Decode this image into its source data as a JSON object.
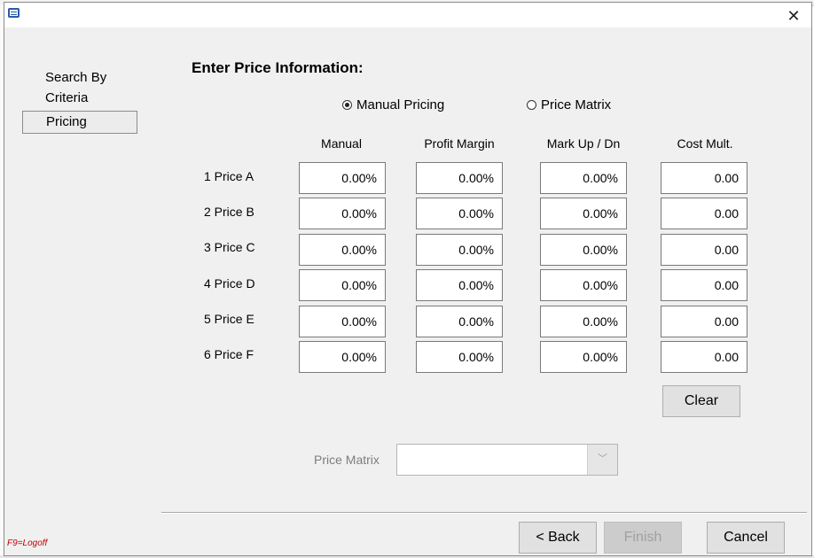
{
  "window": {
    "close_glyph": "✕"
  },
  "nav": {
    "items": [
      {
        "label_line1": "Search By",
        "label_line2": "Criteria"
      },
      {
        "label": "Pricing"
      }
    ]
  },
  "form": {
    "heading": "Enter Price Information:",
    "radios": [
      {
        "label": "Manual Pricing",
        "selected": true
      },
      {
        "label": "Price Matrix",
        "selected": false
      }
    ],
    "columns": [
      "Manual",
      "Profit Margin",
      "Mark Up / Dn",
      "Cost Mult."
    ],
    "rows": [
      {
        "label": "1 Price A",
        "values": [
          "0.00%",
          "0.00%",
          "0.00%",
          "0.00"
        ]
      },
      {
        "label": "2 Price B",
        "values": [
          "0.00%",
          "0.00%",
          "0.00%",
          "0.00"
        ]
      },
      {
        "label": "3 Price C",
        "values": [
          "0.00%",
          "0.00%",
          "0.00%",
          "0.00"
        ]
      },
      {
        "label": "4 Price D",
        "values": [
          "0.00%",
          "0.00%",
          "0.00%",
          "0.00"
        ]
      },
      {
        "label": "5 Price E",
        "values": [
          "0.00%",
          "0.00%",
          "0.00%",
          "0.00"
        ]
      },
      {
        "label": "6 Price F",
        "values": [
          "0.00%",
          "0.00%",
          "0.00%",
          "0.00"
        ]
      }
    ],
    "clear_label": "Clear",
    "price_matrix_label": "Price Matrix",
    "price_matrix_value": "",
    "dropdown_glyph": "﹀"
  },
  "footer": {
    "back_label": "< Back",
    "finish_label": "Finish",
    "cancel_label": "Cancel",
    "logoff_hint": "F9=Logoff"
  },
  "colors": {
    "dialog_bg": "#f0f0f0",
    "button_bg": "#e1e1e1",
    "logoff_text": "#c00000",
    "disabled_text": "#a0a0a0"
  }
}
